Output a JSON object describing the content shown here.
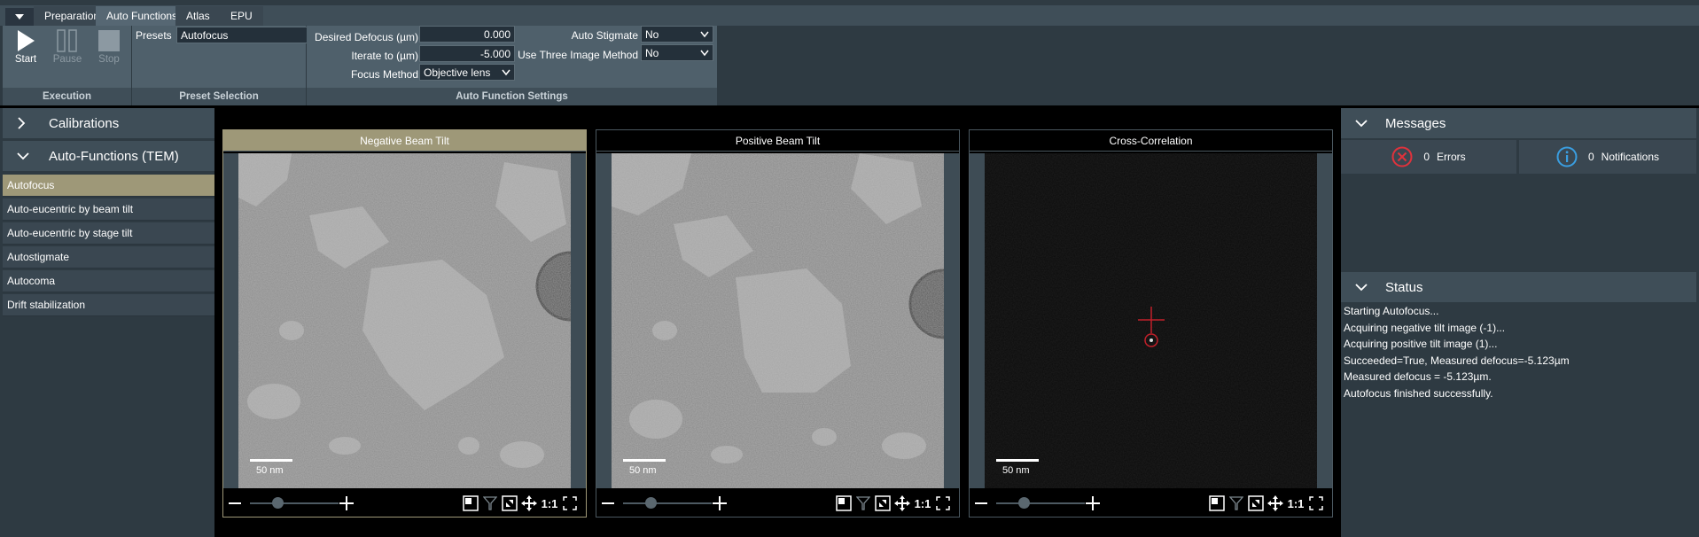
{
  "tabs": [
    {
      "label": "Preparation",
      "active": false
    },
    {
      "label": "Auto Functions",
      "active": true
    },
    {
      "label": "Atlas",
      "active": false
    },
    {
      "label": "EPU",
      "active": false
    }
  ],
  "ribbon": {
    "execution": {
      "group_label": "Execution",
      "start_label": "Start",
      "pause_label": "Pause",
      "stop_label": "Stop"
    },
    "preset_selection": {
      "group_label": "Preset Selection",
      "presets_label": "Presets",
      "presets_value": "Autofocus"
    },
    "settings": {
      "group_label": "Auto Function Settings",
      "desired_defocus_label": "Desired Defocus (µm)",
      "desired_defocus_value": "0.000",
      "iterate_to_label": "Iterate to (µm)",
      "iterate_to_value": "-5.000",
      "focus_method_label": "Focus Method",
      "focus_method_value": "Objective lens",
      "auto_stigmate_label": "Auto Stigmate",
      "auto_stigmate_value": "No",
      "three_image_label": "Use Three Image Method",
      "three_image_value": "No"
    }
  },
  "sidebar": {
    "calibrations_label": "Calibrations",
    "autofunctions_label": "Auto-Functions (TEM)",
    "items": [
      {
        "label": "Autofocus",
        "selected": true
      },
      {
        "label": "Auto-eucentric by beam tilt",
        "selected": false
      },
      {
        "label": "Auto-eucentric by stage tilt",
        "selected": false
      },
      {
        "label": "Autostigmate",
        "selected": false
      },
      {
        "label": "Autocoma",
        "selected": false
      },
      {
        "label": "Drift stabilization",
        "selected": false
      }
    ]
  },
  "viewers": [
    {
      "title": "Negative Beam Tilt",
      "scale": "50 nm",
      "zoom_1to1": "1:1"
    },
    {
      "title": "Positive Beam Tilt",
      "scale": "50 nm",
      "zoom_1to1": "1:1"
    },
    {
      "title": "Cross-Correlation",
      "scale": "50 nm",
      "zoom_1to1": "1:1"
    }
  ],
  "messages": {
    "header": "Messages",
    "errors_count": "0",
    "errors_label": "Errors",
    "notifications_count": "0",
    "notifications_label": "Notifications"
  },
  "status": {
    "header": "Status",
    "lines": [
      "Starting Autofocus...",
      "Acquiring negative tilt image (-1)...",
      "Acquiring positive tilt image (1)...",
      "Succeeded=True, Measured defocus=-5.123µm",
      "Measured defocus = -5.123µm.",
      "Autofocus finished successfully."
    ]
  },
  "colors": {
    "accent_selected": "#9e9878",
    "error_icon": "#e0323c",
    "info_icon": "#3a9ee0"
  }
}
